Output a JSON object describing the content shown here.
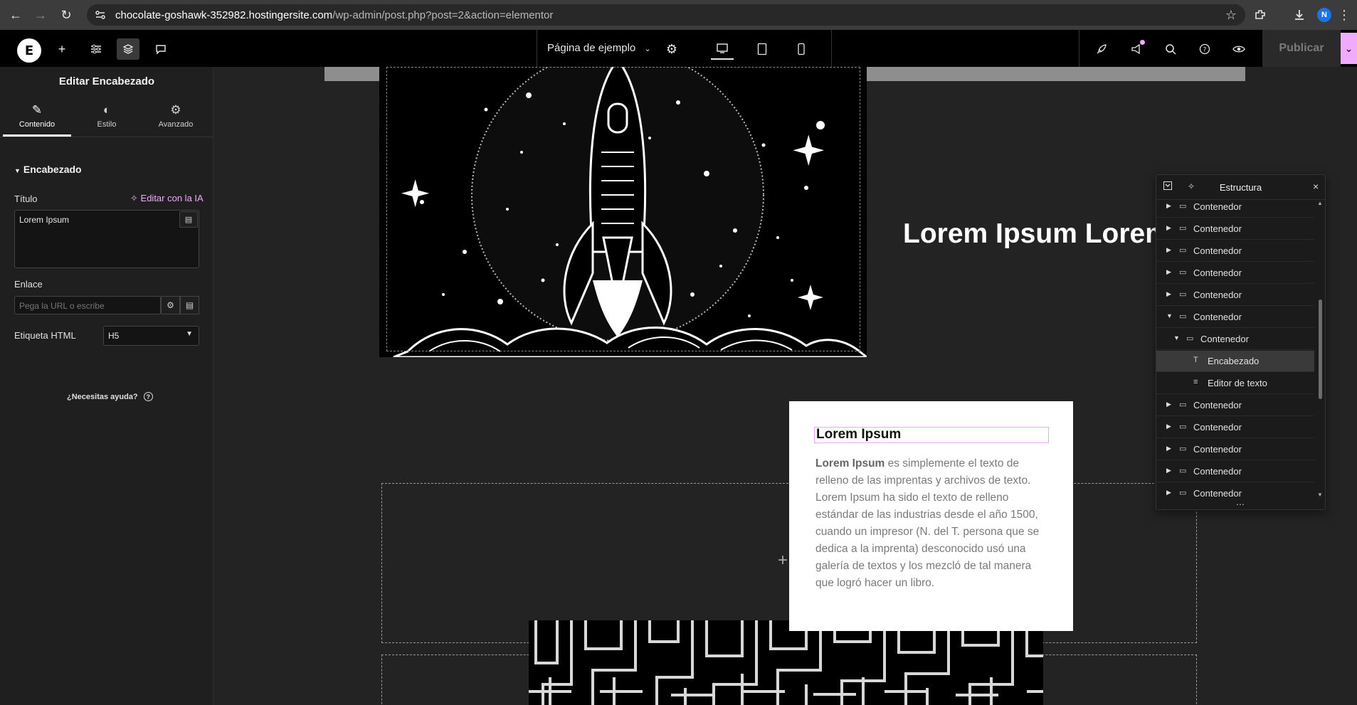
{
  "browser": {
    "url_host": "chocolate-goshawk-352982.hostingersite.com",
    "url_path": "/wp-admin/post.php?post=2&action=elementor",
    "profile_initial": "N"
  },
  "topbar": {
    "page_name": "Página de ejemplo",
    "publish_label": "Publicar"
  },
  "panel": {
    "title": "Editar Encabezado",
    "tabs": [
      {
        "label": "Contenido",
        "icon": "pencil-icon"
      },
      {
        "label": "Estilo",
        "icon": "half-circle-icon"
      },
      {
        "label": "Avanzado",
        "icon": "gear-icon"
      }
    ],
    "section_title": "Encabezado",
    "title_label": "Título",
    "ai_edit_label": "Editar con la IA",
    "title_value": "Lorem Ipsum",
    "link_label": "Enlace",
    "link_placeholder": "Pega la URL o escribe",
    "html_tag_label": "Etiqueta HTML",
    "html_tag_value": "H5",
    "help_label": "¿Necesitas ayuda?"
  },
  "canvas": {
    "big_heading": "Lorem Ipsum Lorem Ipsum Lorem Ipsum",
    "card_heading": "Lorem Ipsum",
    "card_text_bold": "Lorem Ipsum",
    "card_text_rest": " es simplemente el texto de relleno de las imprentas y archivos de texto. Lorem Ipsum ha sido el texto de relleno estándar de las industrias desde el año 1500, cuando un impresor (N. del T. persona que se dedica a la imprenta) desconocido usó una galería de textos y los mezcló de tal manera que logró hacer un libro."
  },
  "structure": {
    "title": "Estructura",
    "items": [
      {
        "label": "Contenedor",
        "depth": 0,
        "expanded": false,
        "type": "container"
      },
      {
        "label": "Contenedor",
        "depth": 0,
        "expanded": false,
        "type": "container"
      },
      {
        "label": "Contenedor",
        "depth": 0,
        "expanded": false,
        "type": "container"
      },
      {
        "label": "Contenedor",
        "depth": 0,
        "expanded": false,
        "type": "container"
      },
      {
        "label": "Contenedor",
        "depth": 0,
        "expanded": false,
        "type": "container"
      },
      {
        "label": "Contenedor",
        "depth": 0,
        "expanded": true,
        "type": "container"
      },
      {
        "label": "Contenedor",
        "depth": 1,
        "expanded": true,
        "type": "container"
      },
      {
        "label": "Encabezado",
        "depth": 2,
        "type": "heading",
        "selected": true
      },
      {
        "label": "Editor de texto",
        "depth": 2,
        "type": "text-editor"
      },
      {
        "label": "Contenedor",
        "depth": 0,
        "expanded": false,
        "type": "container"
      },
      {
        "label": "Contenedor",
        "depth": 0,
        "expanded": false,
        "type": "container"
      },
      {
        "label": "Contenedor",
        "depth": 0,
        "expanded": false,
        "type": "container"
      },
      {
        "label": "Contenedor",
        "depth": 0,
        "expanded": false,
        "type": "container"
      },
      {
        "label": "Contenedor",
        "depth": 0,
        "expanded": false,
        "type": "container"
      }
    ]
  },
  "colors": {
    "accent": "#f0abfc",
    "panel_bg": "#1f1f1f",
    "canvas_bg": "#232323"
  }
}
